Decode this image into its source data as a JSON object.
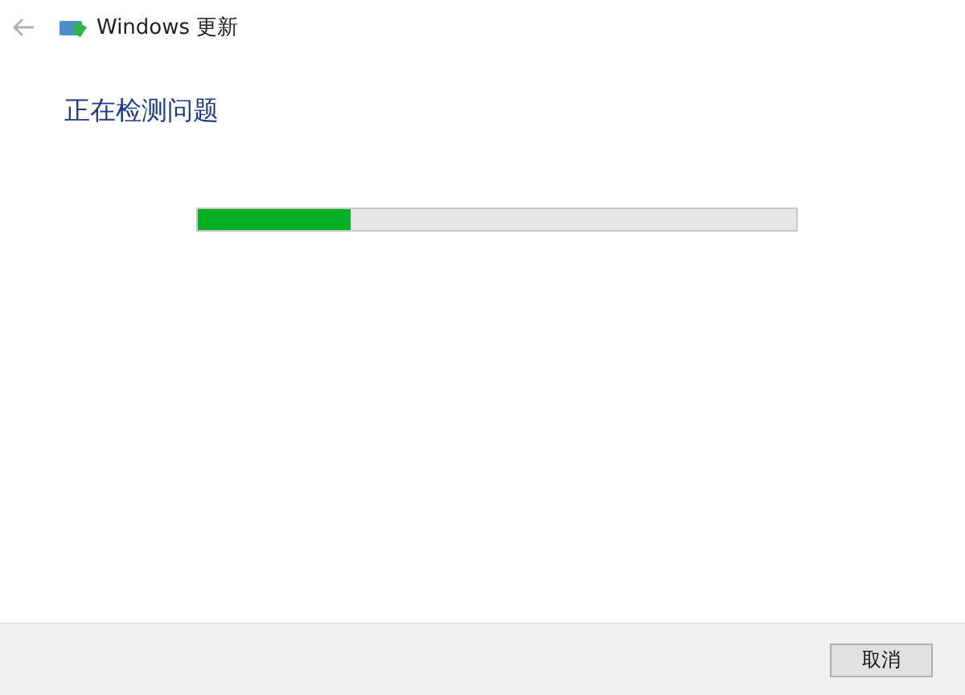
{
  "window": {
    "title": "Windows 更新"
  },
  "heading": "正在检测问题",
  "progress": {
    "level": 0.255
  },
  "buttons": [
    "取消"
  ]
}
